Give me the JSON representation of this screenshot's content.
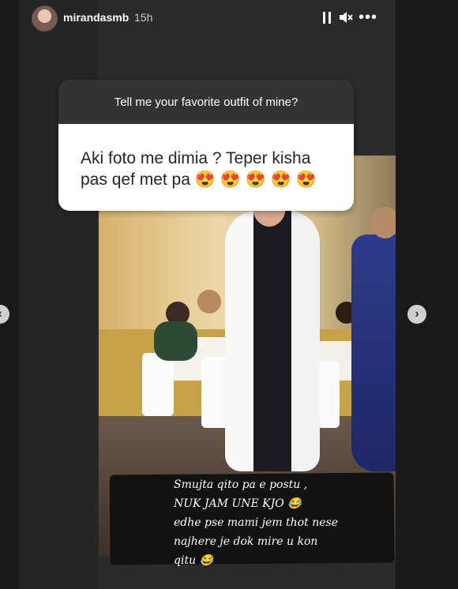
{
  "header": {
    "username": "mirandasmb",
    "time": "15h"
  },
  "question": {
    "prompt": "Tell me your favorite outfit of mine?",
    "answer_line1": "Aki foto me dimia ? Teper kisha",
    "answer_line2": "pas qef met pa 😍 😍 😍 😍 😍"
  },
  "caption": {
    "line1": "Smujta qito pa e postu ,",
    "line2": "NUK JAM UNE KJO 😂",
    "line3": "edhe pse mami jem thot nese",
    "line4": "najhere je dok mire u kon",
    "line5": "qitu 😂"
  },
  "nav": {
    "prev": "‹",
    "next": "›"
  },
  "icons": {
    "pause": "pause-icon",
    "mute": "mute-icon",
    "more": "more-options-icon"
  }
}
